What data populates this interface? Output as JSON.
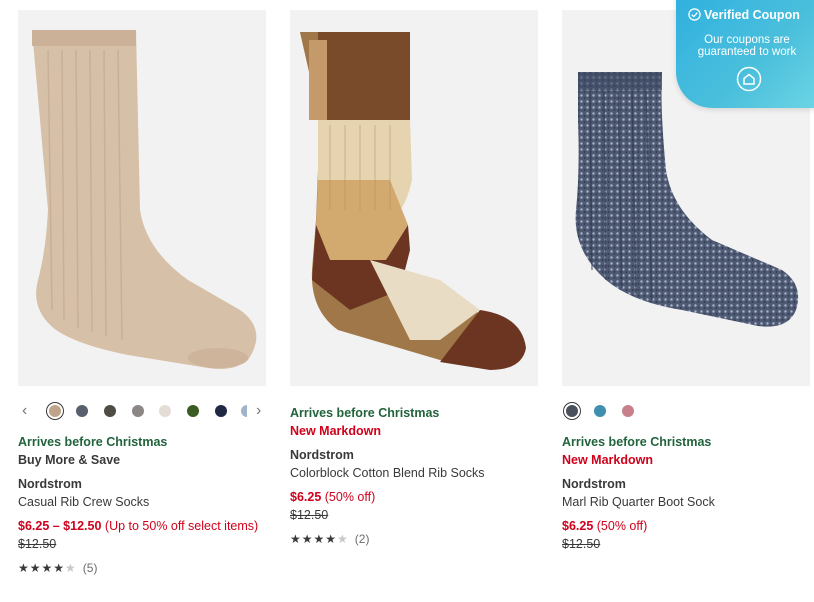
{
  "products": [
    {
      "delivery": "Arrives before Christmas",
      "promo": "Buy More & Save",
      "brand": "Nordstrom",
      "name": "Casual Rib Crew Socks",
      "price": "$6.25 – $12.50",
      "discount": "(Up to 50% off select items)",
      "original_price": "$12.50",
      "stars_filled": "★★★★",
      "stars_empty": "★",
      "rating_value": 4.5,
      "review_count": "(5)",
      "swatch_colors": [
        "#bfa38a",
        "#5a5f6e",
        "#4f4b45",
        "#8c8784",
        "#e3ddd5",
        "#3c5a24",
        "#202844",
        "#9fb4c8"
      ],
      "prev_arrow": "‹",
      "next_arrow": "›"
    },
    {
      "delivery": "Arrives before Christmas",
      "promo": "New Markdown",
      "brand": "Nordstrom",
      "name": "Colorblock Cotton Blend Rib Socks",
      "price": "$6.25",
      "discount": "(50% off)",
      "original_price": "$12.50",
      "stars_filled": "★★★★",
      "stars_empty": "★",
      "rating_value": 4,
      "review_count": "(2)"
    },
    {
      "delivery": "Arrives before Christmas",
      "promo": "New Markdown",
      "brand": "Nordstrom",
      "name": "Marl Rib Quarter Boot Sock",
      "price": "$6.25",
      "discount": "(50% off)",
      "original_price": "$12.50",
      "swatch_colors": [
        "#4a505c",
        "#3f8fb0",
        "#c77f8a"
      ]
    }
  ],
  "coupon": {
    "title": "Verified Coupon",
    "subtitle": "Our coupons are guaranteed to work",
    "icons": [
      "check-circle-icon",
      "home-icon"
    ]
  },
  "colors": {
    "green": "#21643b",
    "sale_red": "#d0011b",
    "text": "#393939",
    "coupon_bg": "#3bb6e0"
  }
}
